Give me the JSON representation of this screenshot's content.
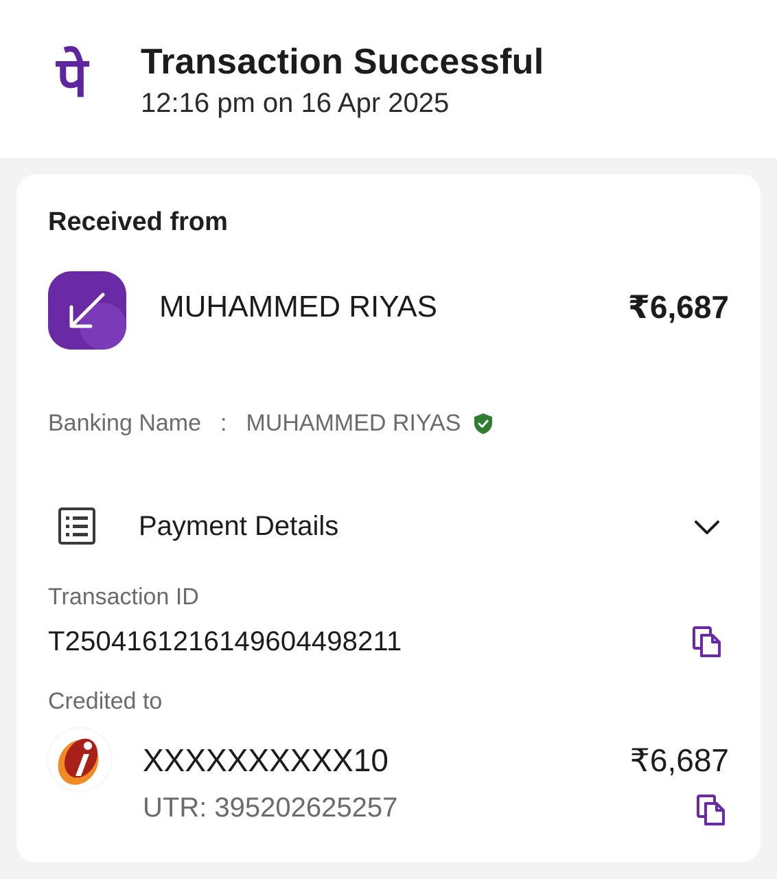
{
  "header": {
    "brand_glyph": "पे",
    "title": "Transaction Successful",
    "timestamp": "12:16 pm on 16 Apr 2025"
  },
  "received": {
    "section_label": "Received from",
    "icon": "arrow-down-left-icon",
    "name": "MUHAMMED RIYAS",
    "amount": "₹6,687"
  },
  "banking": {
    "label": "Banking Name",
    "separator": ":",
    "name": "MUHAMMED RIYAS",
    "verified_icon": "verified-shield-icon"
  },
  "payment_details": {
    "label": "Payment Details",
    "icon": "receipt-list-icon",
    "toggle_icon": "chevron-down-icon"
  },
  "transaction": {
    "id_label": "Transaction ID",
    "id_value": "T2504161216149604498211"
  },
  "credited": {
    "label": "Credited to",
    "bank_logo": "icici-bank-logo",
    "account": "XXXXXXXXXX10",
    "amount": "₹6,687",
    "utr": "UTR: 395202625257"
  },
  "colors": {
    "brand_purple": "#5f259f",
    "verified_green": "#2e7d32",
    "muted_text": "#6b6b6b",
    "background": "#f3f3f3"
  }
}
